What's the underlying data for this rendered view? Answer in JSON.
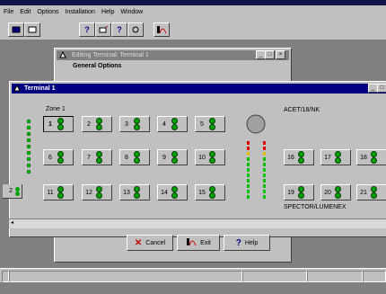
{
  "menubar": {
    "items": [
      "File",
      "Edit",
      "Options",
      "Installation",
      "Help",
      "Window"
    ]
  },
  "toolbar": {
    "icons": [
      "panel-icon",
      "list-icon",
      "help-icon",
      "image-icon",
      "install-icon",
      "clock-icon",
      "lumenex-icon"
    ]
  },
  "edit_dialog": {
    "title": "Editing Terminal: Terminal 1",
    "section_label": "General Options",
    "buttons": {
      "cancel": "Cancel",
      "exit": "Exit",
      "help": "Help"
    }
  },
  "terminal_window": {
    "title": "Terminal 1",
    "zone_header": "Zone 1",
    "model_label": "ACET/18/NK",
    "brand_label": "SPECTOR/LUMENEX",
    "rows": [
      [
        "1",
        "2",
        "3",
        "4",
        "5"
      ],
      [
        "6",
        "7",
        "8",
        "9",
        "10"
      ],
      [
        "11",
        "12",
        "13",
        "14",
        "15"
      ]
    ],
    "right_rows": [
      [
        "16",
        "17",
        "18"
      ],
      [
        "19",
        "20",
        "21"
      ]
    ],
    "left_partial": "2",
    "active_zone": "1"
  },
  "colors": {
    "title_active": "#000080",
    "title_inactive": "#808080",
    "led_green": "#00c000",
    "led_yellow": "#e0c000",
    "led_red": "#e00000",
    "cancel_x": "#c00000"
  }
}
